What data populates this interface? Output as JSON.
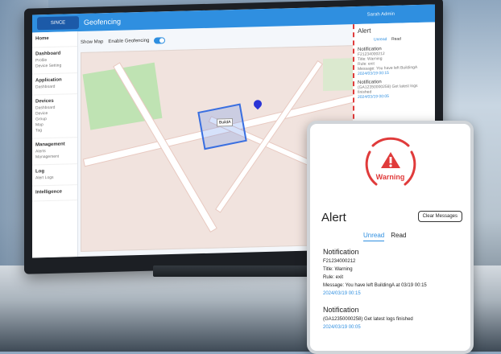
{
  "app": {
    "title": "Geofencing",
    "logo_text": "SINCE",
    "user": "Sarah Admin",
    "toolbar_label": "Show Map",
    "toggle_label": "Enable Geofencing"
  },
  "sidebar": {
    "items": [
      {
        "title": "Home",
        "subs": []
      },
      {
        "title": "Dashboard",
        "subs": [
          "Profile",
          "Device Setting"
        ]
      },
      {
        "title": "Application",
        "subs": [
          "Dashboard"
        ]
      },
      {
        "title": "Devices",
        "subs": [
          "Dashboard",
          "Device",
          "Group",
          "Map",
          "Tag"
        ]
      },
      {
        "title": "Management",
        "subs": [
          "Alerts",
          "Management"
        ]
      },
      {
        "title": "Log",
        "subs": [
          "Alert Logs"
        ]
      },
      {
        "title": "Intelligence",
        "subs": []
      }
    ]
  },
  "map": {
    "fence_label": "BuildA"
  },
  "mini_alert": {
    "title": "Alert",
    "tabs": [
      "Unread",
      "Read"
    ],
    "items": [
      {
        "title": "Notification",
        "lines": [
          "F21234000212",
          "Title: Warning",
          "Rule: exit",
          "Message: You have left BuildingA"
        ],
        "date": "2024/03/19 00:15"
      },
      {
        "title": "Notification",
        "lines": [
          "(GA12350000258) Get latest logs finished"
        ],
        "date": "2024/03/19 00:05"
      }
    ]
  },
  "card": {
    "warning_label": "Warning",
    "title": "Alert",
    "clear_button": "Clear Messages",
    "tab_unread": "Unread",
    "tab_read": "Read",
    "notif1": {
      "title": "Notification",
      "id": "F21234000212",
      "line_title": "Title: Warning",
      "line_rule": "Rule: exit",
      "line_message": "Message: You have left BuildingA at 03/19 00:15",
      "date": "2024/03/19 00:15"
    },
    "notif2": {
      "title": "Notification",
      "message": "(GA12350000258) Get latest logs finished",
      "date": "2024/03/19 00:05"
    }
  },
  "colors": {
    "accent": "#2f8fe0",
    "danger": "#e03b3b",
    "fence": "#3a6fe0"
  }
}
